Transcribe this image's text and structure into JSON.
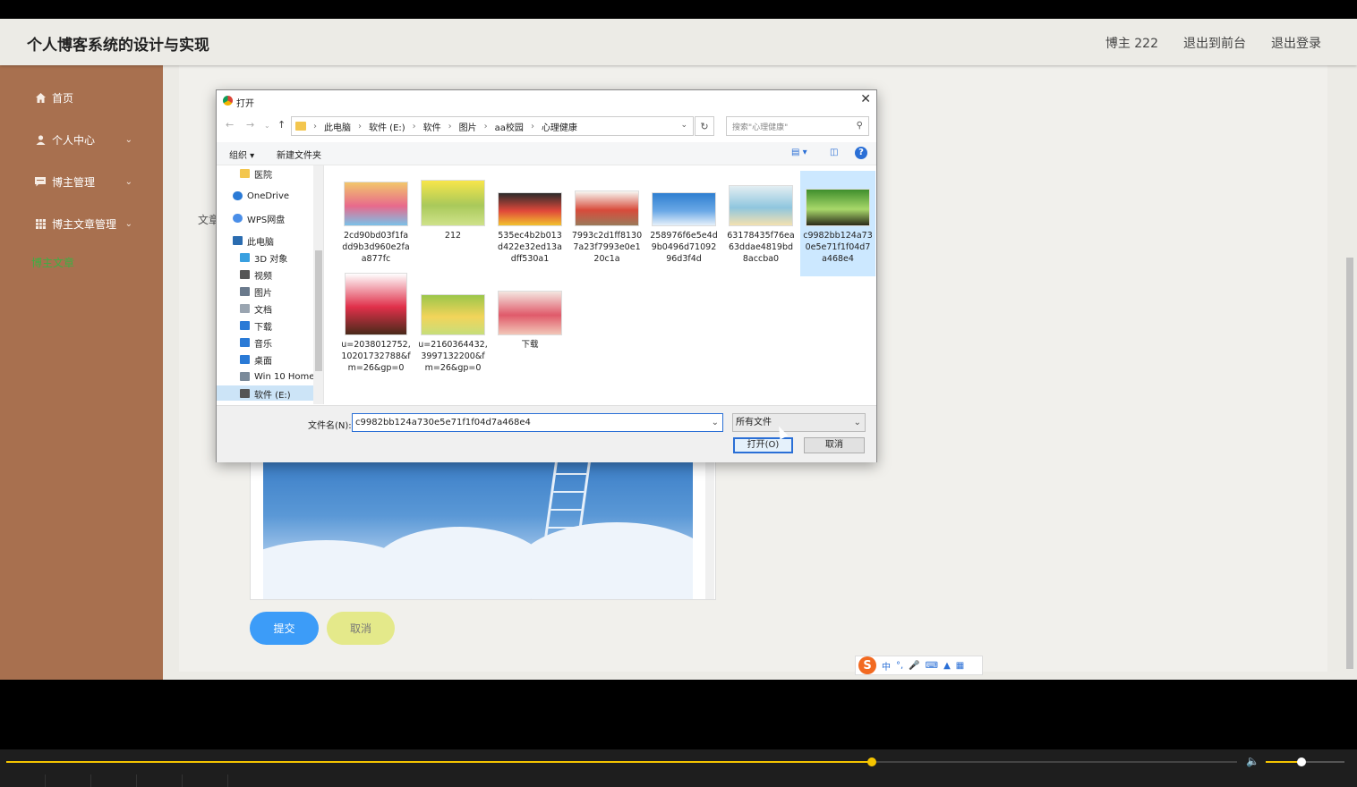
{
  "app": {
    "title": "个人博客系统的设计与实现"
  },
  "header": {
    "links": [
      "博主 222",
      "退出到前台",
      "退出登录"
    ]
  },
  "sidebar": {
    "items": [
      {
        "label": "首页",
        "icon": "home-icon",
        "has_chevron": false
      },
      {
        "label": "个人中心",
        "icon": "user-icon",
        "has_chevron": true
      },
      {
        "label": "博主管理",
        "icon": "chat-icon",
        "has_chevron": true
      },
      {
        "label": "博主文章管理",
        "icon": "grid-icon",
        "has_chevron": true
      }
    ],
    "active_sub": "博主文章"
  },
  "form": {
    "partial_label": "文章",
    "submit_label": "提交",
    "cancel_label": "取消"
  },
  "ime": {
    "logo": "S",
    "mode": "中",
    "punct": "°,"
  },
  "dialog": {
    "title": "打开",
    "breadcrumb": [
      "此电脑",
      "软件 (E:)",
      "软件",
      "图片",
      "aa校园",
      "心理健康"
    ],
    "search_placeholder": "搜索\"心理健康\"",
    "toolbar": {
      "organize": "组织 ▾",
      "new_folder": "新建文件夹"
    },
    "tree": [
      {
        "label": "医院",
        "color": "#f3c64e"
      },
      {
        "label": "OneDrive",
        "color": "#2a7ad6"
      },
      {
        "label": "WPS网盘",
        "color": "#4a8ee8"
      },
      {
        "label": "此电脑",
        "color": "#2b6cb0"
      },
      {
        "label": "3D 对象",
        "color": "#39a0e0"
      },
      {
        "label": "视频",
        "color": "#555555"
      },
      {
        "label": "图片",
        "color": "#6a7a8c"
      },
      {
        "label": "文档",
        "color": "#9aa5b1"
      },
      {
        "label": "下载",
        "color": "#2a7ad6"
      },
      {
        "label": "音乐",
        "color": "#2a7ad6"
      },
      {
        "label": "桌面",
        "color": "#2a7ad6"
      },
      {
        "label": "Win 10 Home",
        "color": "#7a8a9a"
      },
      {
        "label": "软件 (E:)",
        "color": "#555555"
      }
    ],
    "files": [
      {
        "name": "2cd90bd03f1fadd9b3d960e2faa877fc",
        "lines": [
          "2cd90bd03f1fa",
          "dd9b3d960e2fa",
          "a877fc"
        ],
        "colors": [
          "#f2c66b",
          "#e86a8c",
          "#7bc1e8"
        ]
      },
      {
        "name": "212",
        "lines": [
          "212"
        ],
        "colors": [
          "#f7e64a",
          "#a9c95a",
          "#cfe28a"
        ]
      },
      {
        "name": "535ec4b2b013d422e32ed13adff530a1",
        "lines": [
          "535ec4b2b013",
          "d422e32ed13a",
          "dff530a1"
        ],
        "colors": [
          "#2b2b2b",
          "#e0483a",
          "#f2c22e"
        ]
      },
      {
        "name": "7993c2d1ff81307a23f7993e0e120c1a",
        "lines": [
          "7993c2d1ff8130",
          "7a23f7993e0e1",
          "20c1a"
        ],
        "colors": [
          "#f7f7f2",
          "#d84b3b",
          "#9b7a5a"
        ]
      },
      {
        "name": "258976f6e5e4d9b0496d7109296d3f4d",
        "lines": [
          "258976f6e5e4d",
          "9b0496d71092",
          "96d3f4d"
        ],
        "colors": [
          "#2f7fd0",
          "#6aa8e6",
          "#e6f0fa"
        ]
      },
      {
        "name": "63178435f76ea63ddae4819bd8accba0",
        "lines": [
          "63178435f76ea",
          "63ddae4819bd",
          "8accba0"
        ],
        "colors": [
          "#e3eef2",
          "#8fc6de",
          "#f4e1b0"
        ]
      },
      {
        "name": "c9982bb124a730e5e71f1f04d7a468e4",
        "lines": [
          "c9982bb124a73",
          "0e5e71f1f04d7",
          "a468e4"
        ],
        "colors": [
          "#3f8f2d",
          "#a8d86a",
          "#2b2b1a"
        ]
      },
      {
        "name": "u=2038012752,1020173278&fm=26&gp=0",
        "lines": [
          "u=2038012752,",
          "10201732788&f",
          "m=26&gp=0"
        ],
        "colors": [
          "#ffffff",
          "#e0304a",
          "#4a2a1a"
        ]
      },
      {
        "name": "u=2160364432,3997132200&fm=26&gp=0",
        "lines": [
          "u=2160364432,",
          "3997132200&f",
          "m=26&gp=0"
        ],
        "colors": [
          "#9bc64a",
          "#f2d45a",
          "#c7de7a"
        ]
      },
      {
        "name": "下载",
        "lines": [
          "下载"
        ],
        "colors": [
          "#f4e6e0",
          "#e05a6a",
          "#f2c6b8"
        ]
      }
    ],
    "selected_file_index": 6,
    "filename_label": "文件名(N):",
    "filename_value": "c9982bb124a730e5e71f1f04d7a468e4",
    "filetype_value": "所有文件",
    "open_label": "打开(O)",
    "cancel_label": "取消"
  },
  "player": {
    "progress": 0.703,
    "volume": 0.45
  }
}
